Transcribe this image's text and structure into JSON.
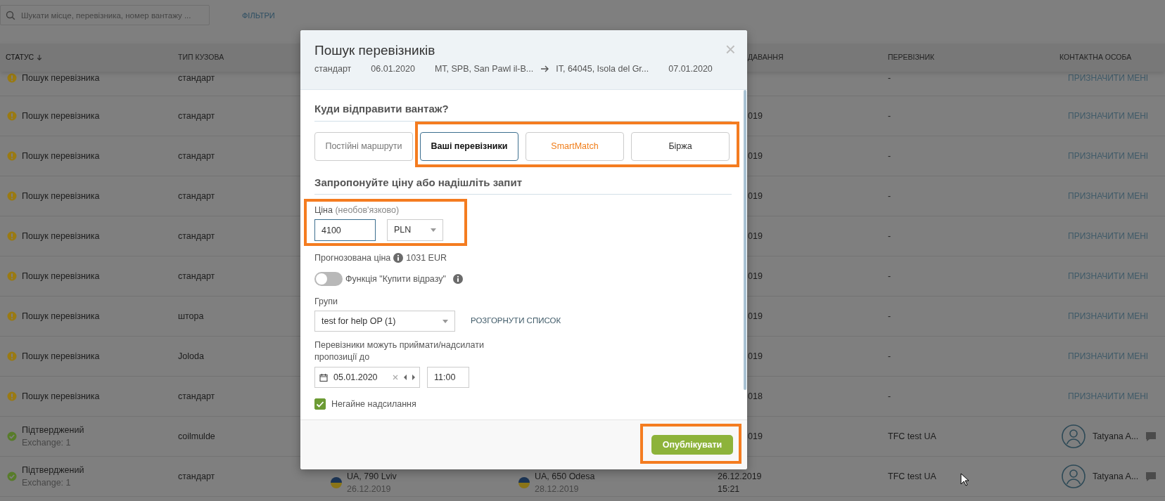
{
  "search": {
    "placeholder": "Шукати місце, перевізника, номер вантажу ..."
  },
  "filters_link": "ФІЛЬТРИ",
  "table": {
    "columns": [
      {
        "label": "СТАТУС",
        "sorted": true
      },
      {
        "label": "ТИП КУЗОВА",
        "sorted": false
      },
      {
        "label": "ДАВАННЯ",
        "sorted": false
      },
      {
        "label": "ПЕРЕВІЗНИК",
        "sorted": false
      },
      {
        "label": "КОНТАКТНА ОСОБА",
        "sorted": false
      }
    ],
    "rows": [
      {
        "status": {
          "kind": "searching",
          "text": "Пошук перевізника"
        },
        "body": "стандарт",
        "carrier": "-",
        "contact": {
          "kind": "assign",
          "text": "ПРИЗНАЧИТИ МЕНІ"
        }
      },
      {
        "status": {
          "kind": "searching",
          "text": "Пошук перевізника"
        },
        "body": "стандарт",
        "date": {
          "cut": true,
          "lines": [
            "019"
          ]
        },
        "carrier": "-",
        "contact": {
          "kind": "assign",
          "text": "ПРИЗНАЧИТИ МЕНІ"
        }
      },
      {
        "status": {
          "kind": "searching",
          "text": "Пошук перевізника"
        },
        "body": "стандарт",
        "date": {
          "cut": true,
          "lines": [
            "019"
          ]
        },
        "carrier": "-",
        "contact": {
          "kind": "assign",
          "text": "ПРИЗНАЧИТИ МЕНІ"
        }
      },
      {
        "status": {
          "kind": "searching",
          "text": "Пошук перевізника"
        },
        "body": "стандарт",
        "date": {
          "cut": true,
          "lines": [
            "019"
          ]
        },
        "carrier": "-",
        "contact": {
          "kind": "assign",
          "text": "ПРИЗНАЧИТИ МЕНІ"
        }
      },
      {
        "status": {
          "kind": "searching",
          "text": "Пошук перевізника"
        },
        "body": "стандарт",
        "date": {
          "cut": true,
          "lines": [
            "019"
          ]
        },
        "carrier": "-",
        "contact": {
          "kind": "assign",
          "text": "ПРИЗНАЧИТИ МЕНІ"
        }
      },
      {
        "status": {
          "kind": "searching",
          "text": "Пошук перевізника"
        },
        "body": "стандарт",
        "date": {
          "cut": true,
          "lines": [
            "019"
          ]
        },
        "carrier": "-",
        "contact": {
          "kind": "assign",
          "text": "ПРИЗНАЧИТИ МЕНІ"
        }
      },
      {
        "status": {
          "kind": "searching",
          "text": "Пошук перевізника"
        },
        "body": "штора",
        "date": {
          "cut": true,
          "lines": [
            "019"
          ]
        },
        "carrier": "-",
        "contact": {
          "kind": "assign",
          "text": "ПРИЗНАЧИТИ МЕНІ"
        }
      },
      {
        "status": {
          "kind": "searching",
          "text": "Пошук перевізника"
        },
        "body": "Joloda",
        "date": {
          "cut": true,
          "lines": [
            "019"
          ]
        },
        "carrier": "-",
        "contact": {
          "kind": "assign",
          "text": "ПРИЗНАЧИТИ МЕНІ"
        }
      },
      {
        "status": {
          "kind": "searching",
          "text": "Пошук перевізника"
        },
        "body": "стандарт",
        "date": {
          "cut": true,
          "lines": [
            "018"
          ]
        },
        "carrier": "-",
        "contact": {
          "kind": "assign",
          "text": "ПРИЗНАЧИТИ МЕНІ"
        }
      },
      {
        "status": {
          "kind": "confirmed",
          "text": "Підтверджений",
          "note": "Exchange: 1"
        },
        "body": "coilmulde",
        "date": {
          "cut": true,
          "lines": [
            "019"
          ]
        },
        "carrier": "TFC test UA",
        "contact": {
          "kind": "person",
          "text": "Tatyana A..."
        }
      },
      {
        "status": {
          "kind": "confirmed",
          "text": "Підтверджений",
          "note": "Exchange: 1"
        },
        "body": "стандарт",
        "loading": {
          "place": "UA, 790 Lviv",
          "date": "26.12.2019"
        },
        "unloading": {
          "place": "UA, 650 Odesa",
          "date": "28.12.2019"
        },
        "date": {
          "cut": false,
          "lines": [
            "26.12.2019",
            "15:21"
          ]
        },
        "carrier": "TFC test UA",
        "contact": {
          "kind": "person",
          "text": "Tatyana A..."
        }
      }
    ]
  },
  "modal": {
    "title": "Пошук перевізників",
    "summary": [
      {
        "kind": "text",
        "text": "стандарт"
      },
      {
        "kind": "text",
        "text": "06.01.2020"
      },
      {
        "kind": "text",
        "text": "MT, SPB, San Pawl il-B..."
      },
      {
        "kind": "arrow"
      },
      {
        "kind": "text",
        "text": "IT, 64045, Isola del Gr..."
      },
      {
        "kind": "text",
        "text": "07.01.2020"
      }
    ],
    "close": "×",
    "destination_heading": "Куди відправити вантаж?",
    "destinations": [
      {
        "label": "Постійні маршрути",
        "kind": "muted",
        "selected": false
      },
      {
        "label": "Ваші перевізники",
        "kind": "normal",
        "selected": true
      },
      {
        "label": "SmartMatch",
        "kind": "accent",
        "selected": false
      },
      {
        "label": "Біржа",
        "kind": "normal",
        "selected": false
      }
    ],
    "offer_heading": "Запропонуйте ціну або надішліть запит",
    "price": {
      "label": "Ціна",
      "hint": "(необов'язково)",
      "value": "4100",
      "currency": "PLN"
    },
    "forecast": {
      "label": "Прогнозована ціна",
      "value": "1031 EUR"
    },
    "buy_now": {
      "label": "Функція \"Купити відразу\"",
      "on": false
    },
    "groups": {
      "label": "Групи",
      "value": "test for help OP (1)",
      "expand_link": "РОЗГОРНУТИ СПИСОК"
    },
    "deadline": {
      "label": "Перевізники можуть приймати/надсилати пропозиції до",
      "date": "05.01.2020",
      "time": "11:00"
    },
    "instant": {
      "label": "Негайне надсилання",
      "checked": true
    },
    "publish_button": "Опублікувати"
  }
}
